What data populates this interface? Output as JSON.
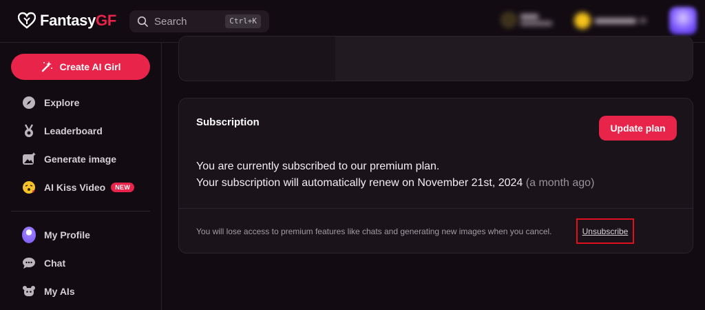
{
  "brand": {
    "name_part1": "Fantasy",
    "name_part2": "GF",
    "accent": "#e8244a"
  },
  "search": {
    "placeholder": "Search",
    "shortcut": "Ctrl+K"
  },
  "header": {
    "coins_icon": "coin-icon",
    "points_icon": "gold-coin-icon",
    "avatar_icon": "user-avatar"
  },
  "sidebar": {
    "create_label": "Create AI Girl",
    "items": [
      {
        "label": "Explore",
        "icon": "compass-icon"
      },
      {
        "label": "Leaderboard",
        "icon": "medal-icon"
      },
      {
        "label": "Generate image",
        "icon": "image-icon"
      },
      {
        "label": "AI Kiss Video",
        "icon": "kiss-emoji-icon",
        "badge": "NEW"
      },
      {
        "label": "My Profile",
        "icon": "profile-avatar"
      },
      {
        "label": "Chat",
        "icon": "chat-icon"
      },
      {
        "label": "My AIs",
        "icon": "robot-icon"
      }
    ]
  },
  "subscription": {
    "title": "Subscription",
    "update_label": "Update plan",
    "line1": "You are currently subscribed to our premium plan.",
    "line2_main": "Your subscription will automatically renew on November 21st, 2024",
    "line2_relative": "(a month ago)",
    "warning": "You will lose access to premium features like chats and generating new images when you cancel.",
    "unsubscribe_label": "Unsubscribe"
  }
}
